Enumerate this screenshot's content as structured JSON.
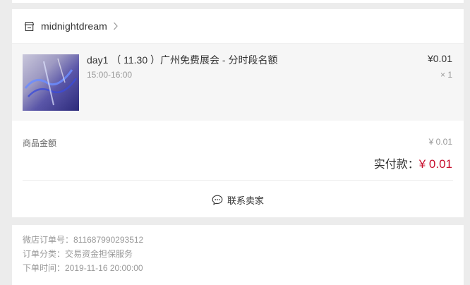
{
  "shop": {
    "name": "midnightdream"
  },
  "item": {
    "title": "day1 （ 11.30 ）广州免费展会 - 分时段名额",
    "subtitle": "15:00-16:00",
    "price": "¥0.01",
    "quantity": "× 1"
  },
  "summary": {
    "goods_label": "商品金额",
    "goods_value": "¥ 0.01",
    "paid_label": "实付款：",
    "paid_amount": "¥ 0.01"
  },
  "contact": {
    "label": "联系卖家"
  },
  "info": {
    "order_no": "微店订单号：811687990293512",
    "order_type": "订单分类：交易资金担保服务",
    "order_time": "下单时间：2019-11-16 20:00:00"
  },
  "colors": {
    "accent": "#c8102e",
    "background": "#ececec"
  },
  "icons": {
    "shop": "store-icon",
    "chevron": "chevron-right-icon",
    "chat": "chat-bubble-icon"
  }
}
